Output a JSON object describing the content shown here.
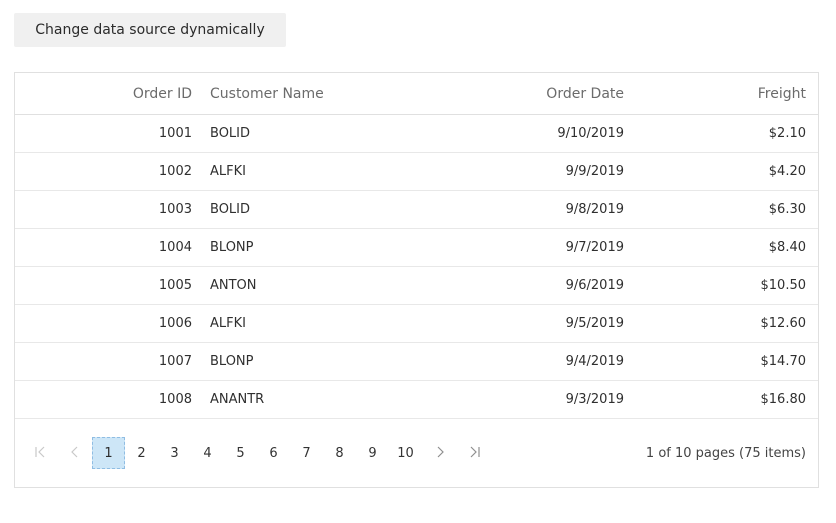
{
  "toolbar": {
    "change_button_label": "Change data source dynamically"
  },
  "grid": {
    "columns": [
      "Order ID",
      "Customer Name",
      "Order Date",
      "Freight"
    ],
    "rows": [
      [
        "1001",
        "BOLID",
        "9/10/2019",
        "$2.10"
      ],
      [
        "1002",
        "ALFKI",
        "9/9/2019",
        "$4.20"
      ],
      [
        "1003",
        "BOLID",
        "9/8/2019",
        "$6.30"
      ],
      [
        "1004",
        "BLONP",
        "9/7/2019",
        "$8.40"
      ],
      [
        "1005",
        "ANTON",
        "9/6/2019",
        "$10.50"
      ],
      [
        "1006",
        "ALFKI",
        "9/5/2019",
        "$12.60"
      ],
      [
        "1007",
        "BLONP",
        "9/4/2019",
        "$14.70"
      ],
      [
        "1008",
        "ANANTR",
        "9/3/2019",
        "$16.80"
      ]
    ]
  },
  "pager": {
    "pages": [
      "1",
      "2",
      "3",
      "4",
      "5",
      "6",
      "7",
      "8",
      "9",
      "10"
    ],
    "current_page": "1",
    "info": "1 of 10 pages (75 items)",
    "icons": {
      "first": "first-page-icon",
      "prev": "previous-page-icon",
      "next": "next-page-icon",
      "last": "last-page-icon"
    }
  }
}
